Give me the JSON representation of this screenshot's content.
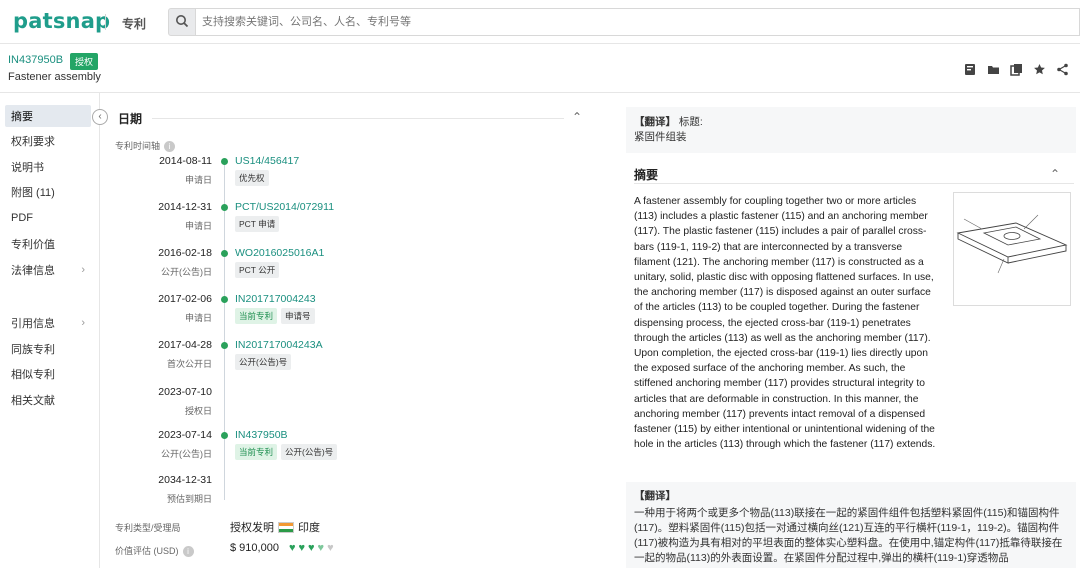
{
  "app": {
    "logo": "patsnap",
    "module": "专利",
    "search_placeholder": "支持搜索关键词、公司名、人名、专利号等"
  },
  "patent": {
    "number": "IN437950B",
    "status_badge": "授权",
    "title": "Fastener assembly"
  },
  "toolbar": [
    "export-icon",
    "folder-icon",
    "copy-icon",
    "star-icon",
    "share-icon"
  ],
  "sidebar": {
    "items": [
      {
        "label": "摘要",
        "active": true,
        "chevron": false
      },
      {
        "label": "权利要求",
        "active": false,
        "chevron": false
      },
      {
        "label": "说明书",
        "active": false,
        "chevron": false
      },
      {
        "label": "附图 (11)",
        "active": false,
        "chevron": false
      },
      {
        "label": "PDF",
        "active": false,
        "chevron": false
      },
      {
        "label": "专利价值",
        "active": false,
        "chevron": false
      },
      {
        "label": "法律信息",
        "active": false,
        "chevron": true
      },
      {
        "label": "引用信息",
        "active": false,
        "chevron": true
      },
      {
        "label": "同族专利",
        "active": false,
        "chevron": false
      },
      {
        "label": "相似专利",
        "active": false,
        "chevron": false
      },
      {
        "label": "相关文献",
        "active": false,
        "chevron": false
      }
    ]
  },
  "dates": {
    "heading": "日期",
    "timeline_label": "专利时间轴",
    "events": [
      {
        "date": "2014-08-11",
        "type": "申请日",
        "number": "US14/456417",
        "tags": [
          {
            "text": "优先权",
            "green": false
          }
        ]
      },
      {
        "date": "2014-12-31",
        "type": "申请日",
        "number": "PCT/US2014/072911",
        "tags": [
          {
            "text": "PCT 申请",
            "green": false
          }
        ]
      },
      {
        "date": "2016-02-18",
        "type": "公开(公告)日",
        "number": "WO2016025016A1",
        "tags": [
          {
            "text": "PCT 公开",
            "green": false
          }
        ]
      },
      {
        "date": "2017-02-06",
        "type": "申请日",
        "number": "IN201717004243",
        "tags": [
          {
            "text": "当前专利",
            "green": true
          },
          {
            "text": "申请号",
            "green": false
          }
        ]
      },
      {
        "date": "2017-04-28",
        "type": "首次公开日",
        "number": "IN201717004243A",
        "tags": [
          {
            "text": "公开(公告)号",
            "green": false
          }
        ]
      },
      {
        "date": "2023-07-10",
        "type": "授权日",
        "number": "",
        "tags": []
      },
      {
        "date": "2023-07-14",
        "type": "公开(公告)日",
        "number": "IN437950B",
        "tags": [
          {
            "text": "当前专利",
            "green": true
          },
          {
            "text": "公开(公告)号",
            "green": false
          }
        ]
      },
      {
        "date": "2034-12-31",
        "type": "预估到期日",
        "number": "",
        "tags": []
      }
    ],
    "patent_type_label": "专利类型/受理局",
    "patent_type_value": "授权发明",
    "office": "印度",
    "value_label": "价值评估 (USD)",
    "value": "$ 910,000",
    "value_hearts": 3.5
  },
  "translation": {
    "label": "【翻译】",
    "title_key": "标题:",
    "title_value": "紧固件组装"
  },
  "abstract": {
    "heading": "摘要",
    "text": "A fastener assembly for coupling together two or more articles (113) includes a plastic fastener (115) and an anchoring member (117). The plastic fastener (115) includes a pair of parallel cross-bars (119-1, 119-2) that are interconnected by a transverse filament (121). The anchoring member (117) is constructed as a unitary, solid, plastic disc with opposing flattened surfaces. In use, the anchoring member (117) is disposed against an outer surface of the articles (113) to be coupled together. During the fastener dispensing process, the ejected cross-bar (119-1) penetrates through the articles (113) as well as the anchoring member (117). Upon completion, the ejected cross-bar (119-1) lies directly upon the exposed surface of the anchoring member. As such, the stiffened anchoring member (117) provides structural integrity to articles that are deformable in construction. In this manner, the anchoring member (117) prevents intact removal of a dispensed fastener (115) by either intentional or unintentional widening of the hole in the articles (113) through which the fastener (117) extends."
  },
  "translation2": {
    "label": "【翻译】",
    "text": "一种用于将两个或更多个物品(113)联接在一起的紧固件组件包括塑料紧固件(115)和锚固构件(117)。塑料紧固件(115)包括一对通过横向丝(121)互连的平行横杆(119-1，119-2)。锚固构件(117)被构造为具有相对的平坦表面的整体实心塑料盘。在使用中,锚定构件(117)抵靠待联接在一起的物品(113)的外表面设置。在紧固件分配过程中,弹出的横杆(119-1)穿透物品"
  }
}
